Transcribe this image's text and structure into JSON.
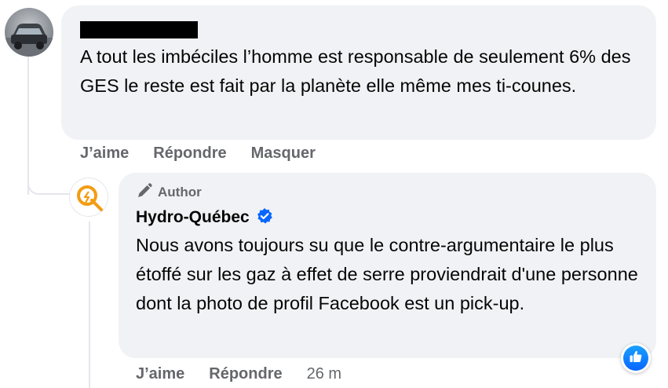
{
  "comment": {
    "text": "A tout les imbéciles l’homme est responsable de seulement 6% des GES le reste est fait par la planète elle même mes ti-counes.",
    "actions": {
      "like": "J’aime",
      "reply": "Répondre",
      "hide": "Masquer"
    }
  },
  "reply": {
    "badge": "Author",
    "author": "Hydro-Québec",
    "text": "Nous avons toujours su que le contre-argumentaire le plus étoffé sur les gaz à effet de serre proviendrait d'une personne dont la photo de profil Facebook est un pick-up.",
    "actions": {
      "like": "J’aime",
      "reply": "Répondre",
      "time": "26 m"
    }
  },
  "colors": {
    "bubble": "#f0f2f5",
    "secondary_text": "#65676b",
    "verified_blue": "#0866ff",
    "hq_orange": "#f39c12"
  },
  "icons": [
    "verified-badge-icon",
    "pencil-icon",
    "thumbs-up-icon",
    "hydro-quebec-logo"
  ]
}
